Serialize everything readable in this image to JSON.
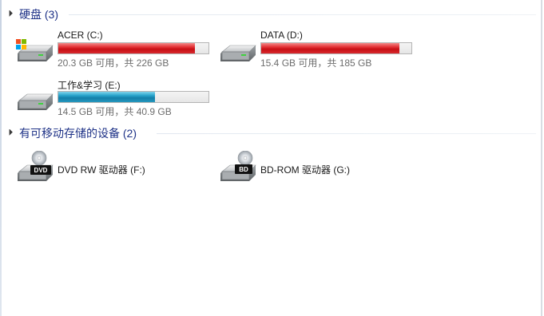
{
  "groups": [
    {
      "label": "硬盘 (3)",
      "drives": [
        {
          "name": "ACER (C:)",
          "free_text": "20.3 GB 可用，共 226 GB",
          "used_fraction": 0.91,
          "bar_color": "#c80f14",
          "icon": "hard-drive-windows-icon"
        },
        {
          "name": "DATA (D:)",
          "free_text": "15.4 GB 可用，共 185 GB",
          "used_fraction": 0.92,
          "bar_color": "#c80f14",
          "icon": "hard-drive-icon"
        },
        {
          "name": "工作&学习 (E:)",
          "free_text": "14.5 GB 可用，共 40.9 GB",
          "used_fraction": 0.645,
          "bar_color": "#137fa8",
          "icon": "hard-drive-icon"
        }
      ]
    },
    {
      "label": "有可移动存储的设备 (2)",
      "drives": [
        {
          "name": "DVD RW 驱动器 (F:)",
          "disc_label": "DVD",
          "icon": "dvd-drive-icon"
        },
        {
          "name": "BD-ROM 驱动器 (G:)",
          "disc_label": "BD",
          "icon": "bd-drive-icon"
        }
      ]
    }
  ]
}
